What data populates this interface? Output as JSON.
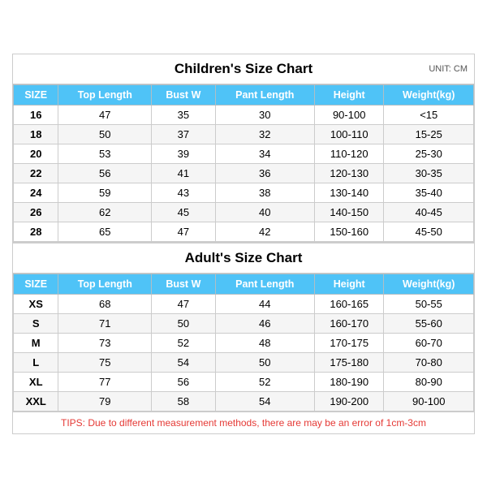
{
  "children_title": "Children's Size Chart",
  "adult_title": "Adult's Size Chart",
  "unit_label": "UNIT: CM",
  "headers": [
    "SIZE",
    "Top Length",
    "Bust W",
    "Pant Length",
    "Height",
    "Weight(kg)"
  ],
  "children_rows": [
    [
      "16",
      "47",
      "35",
      "30",
      "90-100",
      "<15"
    ],
    [
      "18",
      "50",
      "37",
      "32",
      "100-110",
      "15-25"
    ],
    [
      "20",
      "53",
      "39",
      "34",
      "110-120",
      "25-30"
    ],
    [
      "22",
      "56",
      "41",
      "36",
      "120-130",
      "30-35"
    ],
    [
      "24",
      "59",
      "43",
      "38",
      "130-140",
      "35-40"
    ],
    [
      "26",
      "62",
      "45",
      "40",
      "140-150",
      "40-45"
    ],
    [
      "28",
      "65",
      "47",
      "42",
      "150-160",
      "45-50"
    ]
  ],
  "adult_rows": [
    [
      "XS",
      "68",
      "47",
      "44",
      "160-165",
      "50-55"
    ],
    [
      "S",
      "71",
      "50",
      "46",
      "160-170",
      "55-60"
    ],
    [
      "M",
      "73",
      "52",
      "48",
      "170-175",
      "60-70"
    ],
    [
      "L",
      "75",
      "54",
      "50",
      "175-180",
      "70-80"
    ],
    [
      "XL",
      "77",
      "56",
      "52",
      "180-190",
      "80-90"
    ],
    [
      "XXL",
      "79",
      "58",
      "54",
      "190-200",
      "90-100"
    ]
  ],
  "tips": "TIPS: Due to different measurement methods, there are may be an error of 1cm-3cm"
}
